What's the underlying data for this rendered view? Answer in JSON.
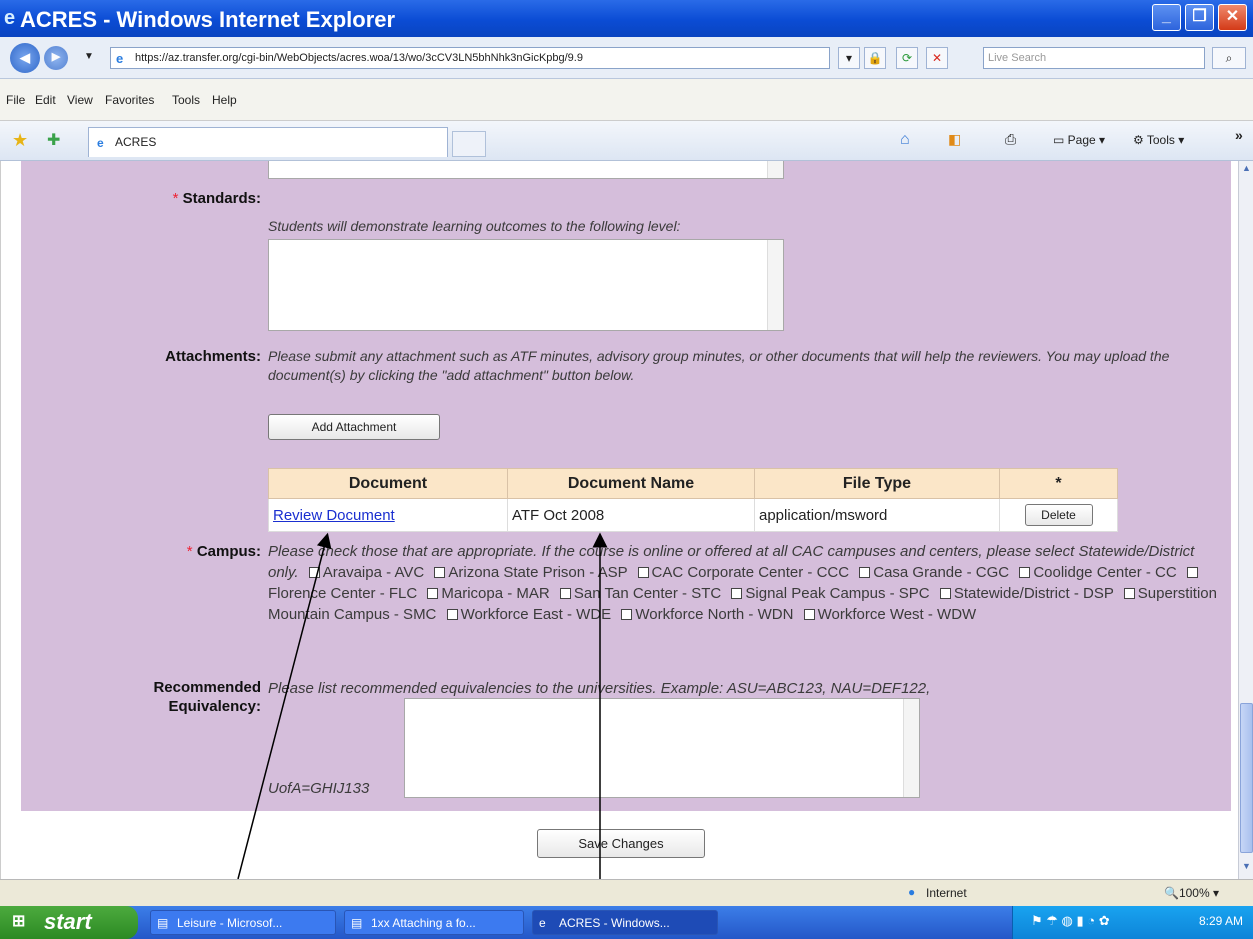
{
  "window": {
    "title": "ACRES - Windows Internet Explorer",
    "min_label": "_",
    "max_label": "❐",
    "close_label": "✕"
  },
  "navbar": {
    "address": "https://az.transfer.org/cgi-bin/WebObjects/acres.woa/13/wo/3cCV3LN5bhNhk3nGicKpbg/9.9",
    "search_placeholder": "Live Search"
  },
  "menubar": [
    "File",
    "Edit",
    "View",
    "Favorites",
    "Tools",
    "Help"
  ],
  "tabbar": {
    "tab_label": "ACRES",
    "page_label": "Page",
    "tools_label": "Tools"
  },
  "form": {
    "standards": {
      "label": "Standards:",
      "help": "Students will demonstrate learning outcomes to the following level:"
    },
    "attachments": {
      "label": "Attachments:",
      "help": "Please submit any attachment such as ATF minutes, advisory group minutes, or other documents that will help the reviewers. You may upload the document(s) by clicking the \"add attachment\" button below.",
      "add_button": "Add Attachment",
      "columns": [
        "Document",
        "Document Name",
        "File Type",
        "*"
      ],
      "rows": [
        {
          "document": "Review Document",
          "name": "ATF Oct 2008",
          "type": "application/msword",
          "action": "Delete"
        }
      ]
    },
    "campus": {
      "label": "Campus:",
      "help": "Please check those that are appropriate. If the course is online or offered at all CAC campuses and centers, please select Statewide/District only.",
      "options": [
        "Aravaipa - AVC",
        "Arizona State Prison - ASP",
        "CAC Corporate Center - CCC",
        "Casa Grande - CGC",
        "Coolidge Center - CC",
        "Florence Center - FLC",
        "Maricopa - MAR",
        "San Tan Center - STC",
        "Signal Peak Campus - SPC",
        "Statewide/District - DSP",
        "Superstition Mountain Campus - SMC",
        "Workforce East - WDE",
        "Workforce North - WDN",
        "Workforce West - WDW"
      ]
    },
    "equivalency": {
      "label_line1": "Recommended",
      "label_line2": "Equivalency:",
      "help": "Please list recommended equivalencies to the universities. Example: ASU=ABC123, NAU=DEF122,",
      "help_tail": "UofA=GHIJ133"
    },
    "save_button": "Save Changes"
  },
  "status": {
    "zone": "Internet",
    "zoom": "100%"
  },
  "taskbar": {
    "start": "start",
    "tasks": [
      "Leisure - Microsof...",
      "1xx Attaching a fo...",
      "ACRES - Windows..."
    ],
    "clock": "8:29 AM"
  }
}
